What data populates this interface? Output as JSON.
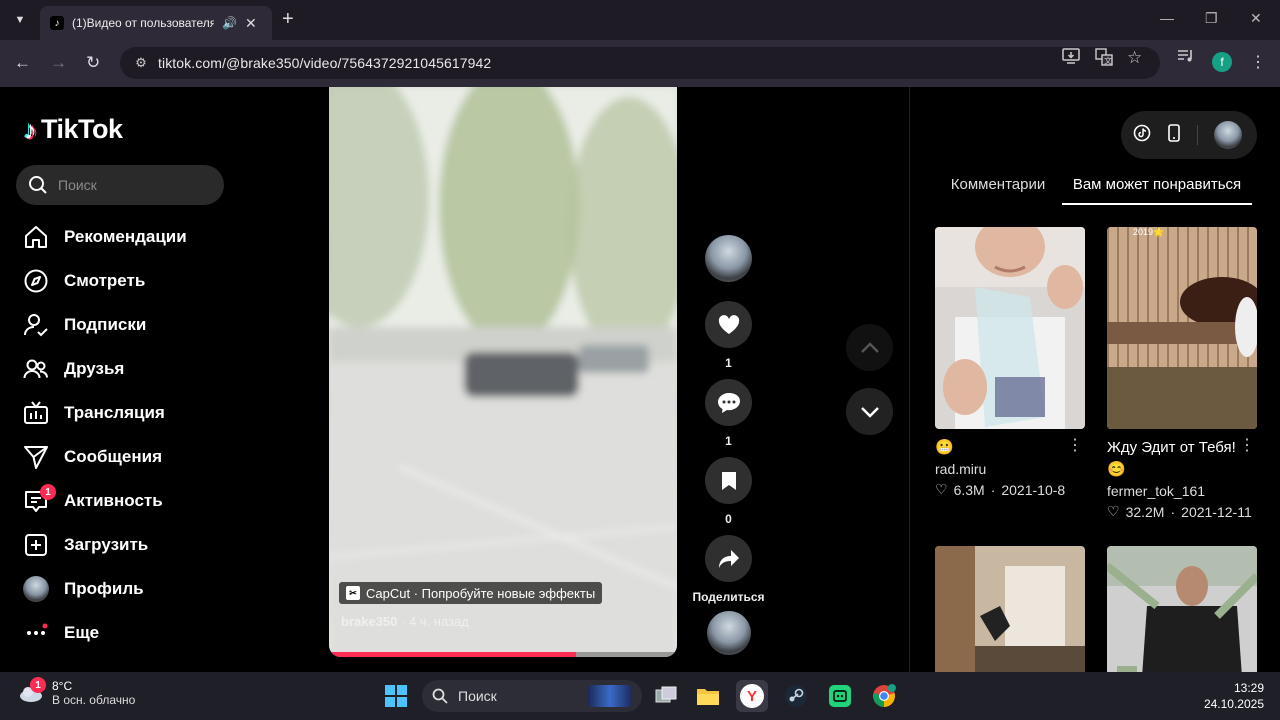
{
  "browser": {
    "tab_title": "(1)Видео от пользователя",
    "url": "tiktok.com/@brake350/video/7564372921045617942",
    "profile_initial": "f"
  },
  "app": {
    "logo_text": "TikTok",
    "search_placeholder": "Поиск",
    "nav": [
      {
        "label": "Рекомендации",
        "icon": "home-icon"
      },
      {
        "label": "Смотреть",
        "icon": "compass-icon"
      },
      {
        "label": "Подписки",
        "icon": "following-icon"
      },
      {
        "label": "Друзья",
        "icon": "friends-icon"
      },
      {
        "label": "Трансляция",
        "icon": "live-icon"
      },
      {
        "label": "Сообщения",
        "icon": "messages-icon"
      },
      {
        "label": "Активность",
        "icon": "activity-icon",
        "badge": "1"
      },
      {
        "label": "Загрузить",
        "icon": "upload-icon"
      },
      {
        "label": "Профиль",
        "icon": "profile-avatar"
      },
      {
        "label": "Еще",
        "icon": "more-dots-icon"
      }
    ]
  },
  "video": {
    "effect_banner": "CapCut · Попробуйте новые эффекты",
    "author": "brake350",
    "time_ago": "· 4 ч. назад",
    "progress": 0.71,
    "likes": "1",
    "comments": "1",
    "saves": "0",
    "share_label": "Поделиться"
  },
  "right_panel": {
    "tabs": [
      "Комментарии",
      "Вам может понравиться"
    ],
    "active_tab": 1,
    "cards": [
      {
        "caption": "😬",
        "author": "rad.miru",
        "likes": "6.3M",
        "date": "2021-10-8"
      },
      {
        "caption": "Жду Эдит от Тебя! 😊",
        "author": "fermer_tok_161",
        "likes": "32.2M",
        "date": "2021-12-11",
        "overlay": "2019🌟"
      }
    ]
  },
  "taskbar": {
    "weather_badge": "1",
    "temperature": "8°C",
    "condition": "В осн. облачно",
    "search_label": "Поиск",
    "time": "13:29",
    "date": "24.10.2025"
  }
}
